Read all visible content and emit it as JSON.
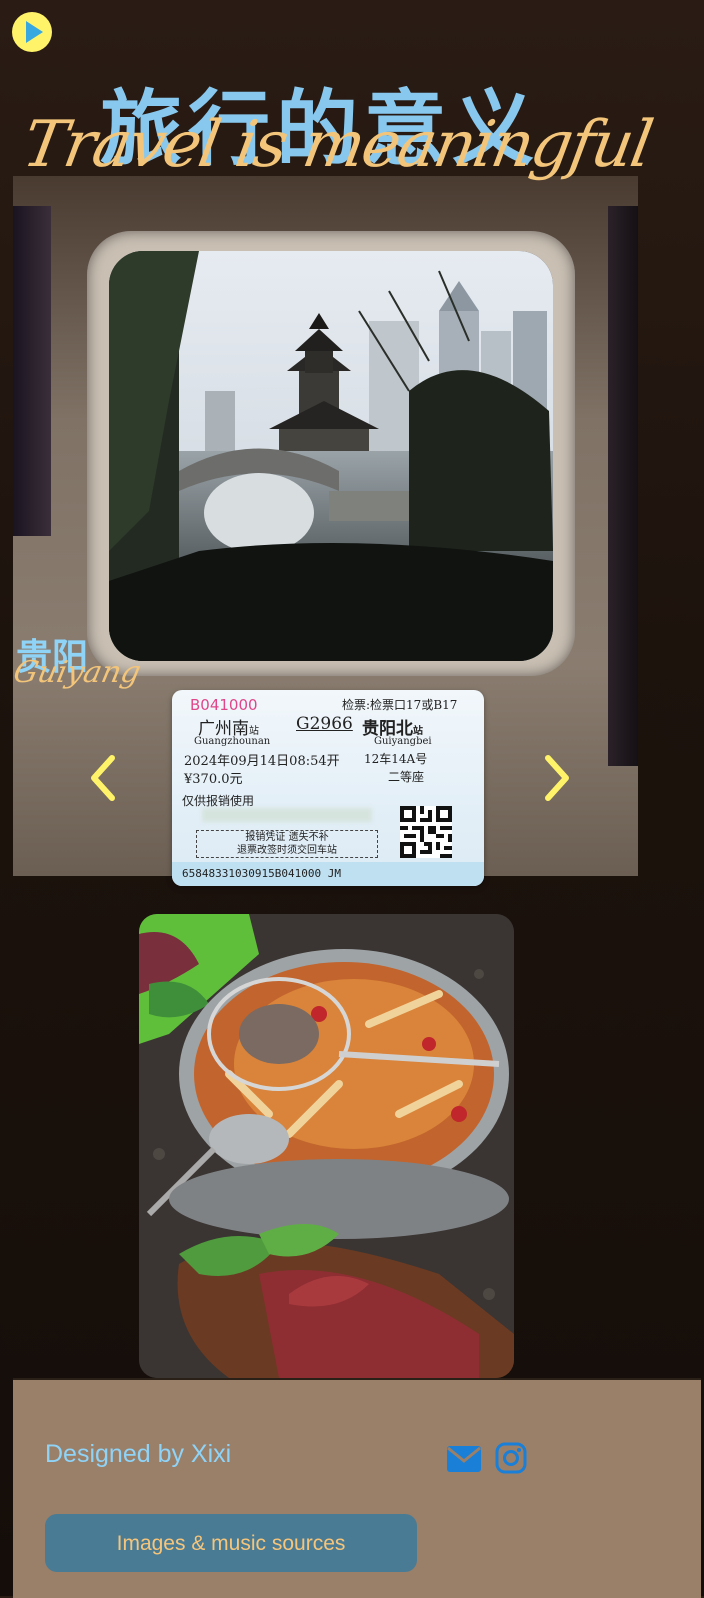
{
  "header": {
    "play_icon": "play-icon",
    "title_cn": "旅行的意义",
    "title_en": "Travel is meaningful"
  },
  "gallery": {
    "city_cn": "贵阳",
    "city_en": "Guiyang",
    "prev_icon": "chevron-left-icon",
    "next_icon": "chevron-right-icon",
    "ticket": {
      "number": "B041000",
      "gate": "检票:检票口17或B17",
      "from_cn": "广州南",
      "from_suffix": "站",
      "from_en": "Guangzhounan",
      "train": "G2966",
      "to_cn": "贵阳北",
      "to_suffix": "站",
      "to_en": "Guiyangbei",
      "datetime": "2024年09月14日08:54开",
      "seat": "12车14A号",
      "price": "¥370.0元",
      "seat_class": "二等座",
      "reimbursement": "仅供报销使用",
      "notice_line1": "报销凭证 遗失不补",
      "notice_line2": "退票改签时须交回车站",
      "serial": "65848331030915B041000 JM"
    }
  },
  "footer": {
    "designer": "Designed by Xixi",
    "mail_icon": "envelope-icon",
    "instagram_icon": "instagram-icon",
    "sources_button": "Images & music sources"
  },
  "colors": {
    "accent_yellow": "#fff36a",
    "title_blue": "#88c8ee",
    "script_gold": "#f3c57a",
    "footer_bg": "#9a7f69",
    "button_bg": "#4a7b94"
  }
}
